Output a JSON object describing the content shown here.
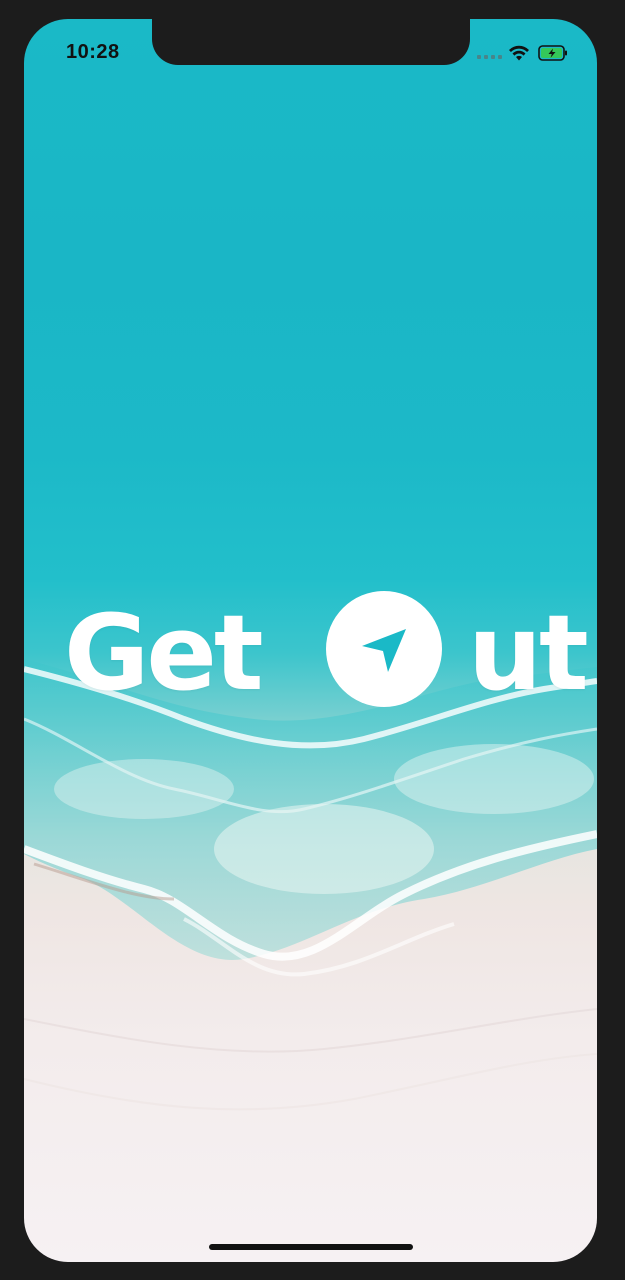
{
  "status_bar": {
    "time": "10:28",
    "icons": [
      "signal-icon",
      "wifi-icon",
      "battery-charging-icon"
    ],
    "battery_color": "#34c759"
  },
  "splash": {
    "logo_text_left": "Get",
    "logo_text_right": "ut",
    "logo_icon": "navigation-arrow-icon",
    "logo_color": "#ffffff",
    "background": "beach-aerial-photo"
  },
  "colors": {
    "sea": "#1ab9c7",
    "sand": "#f3ecec",
    "frame": "#1c1c1c"
  }
}
